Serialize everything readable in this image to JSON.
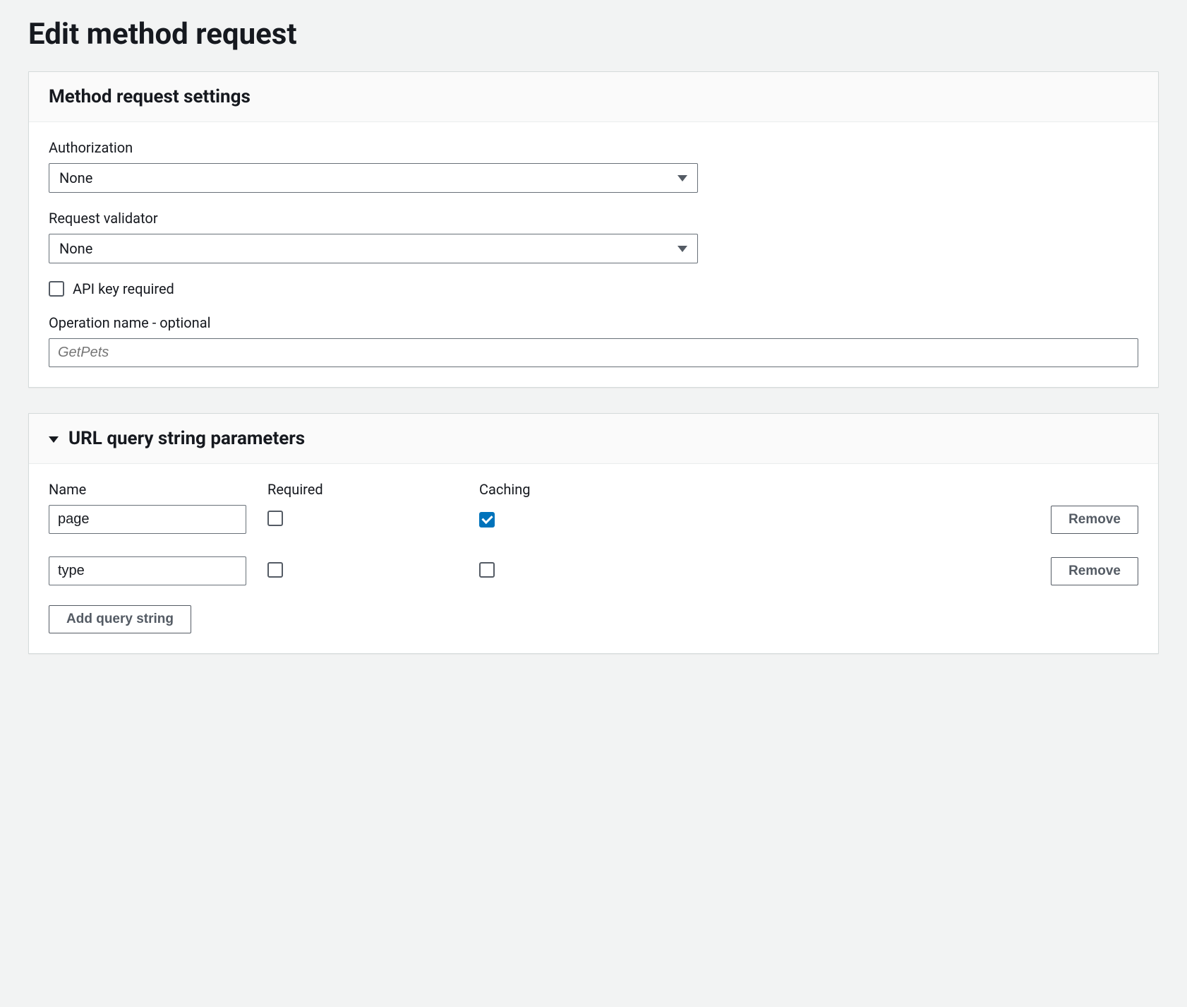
{
  "page": {
    "title": "Edit method request"
  },
  "settings": {
    "panel_title": "Method request settings",
    "authorization": {
      "label": "Authorization",
      "value": "None"
    },
    "request_validator": {
      "label": "Request validator",
      "value": "None"
    },
    "api_key_required": {
      "label": "API key required",
      "checked": false
    },
    "operation_name": {
      "label": "Operation name - optional",
      "placeholder": "GetPets",
      "value": ""
    }
  },
  "query_params": {
    "panel_title": "URL query string parameters",
    "columns": {
      "name": "Name",
      "required": "Required",
      "caching": "Caching"
    },
    "rows": [
      {
        "name": "page",
        "required": false,
        "caching": true
      },
      {
        "name": "type",
        "required": false,
        "caching": false
      }
    ],
    "remove_label": "Remove",
    "add_label": "Add query string"
  }
}
